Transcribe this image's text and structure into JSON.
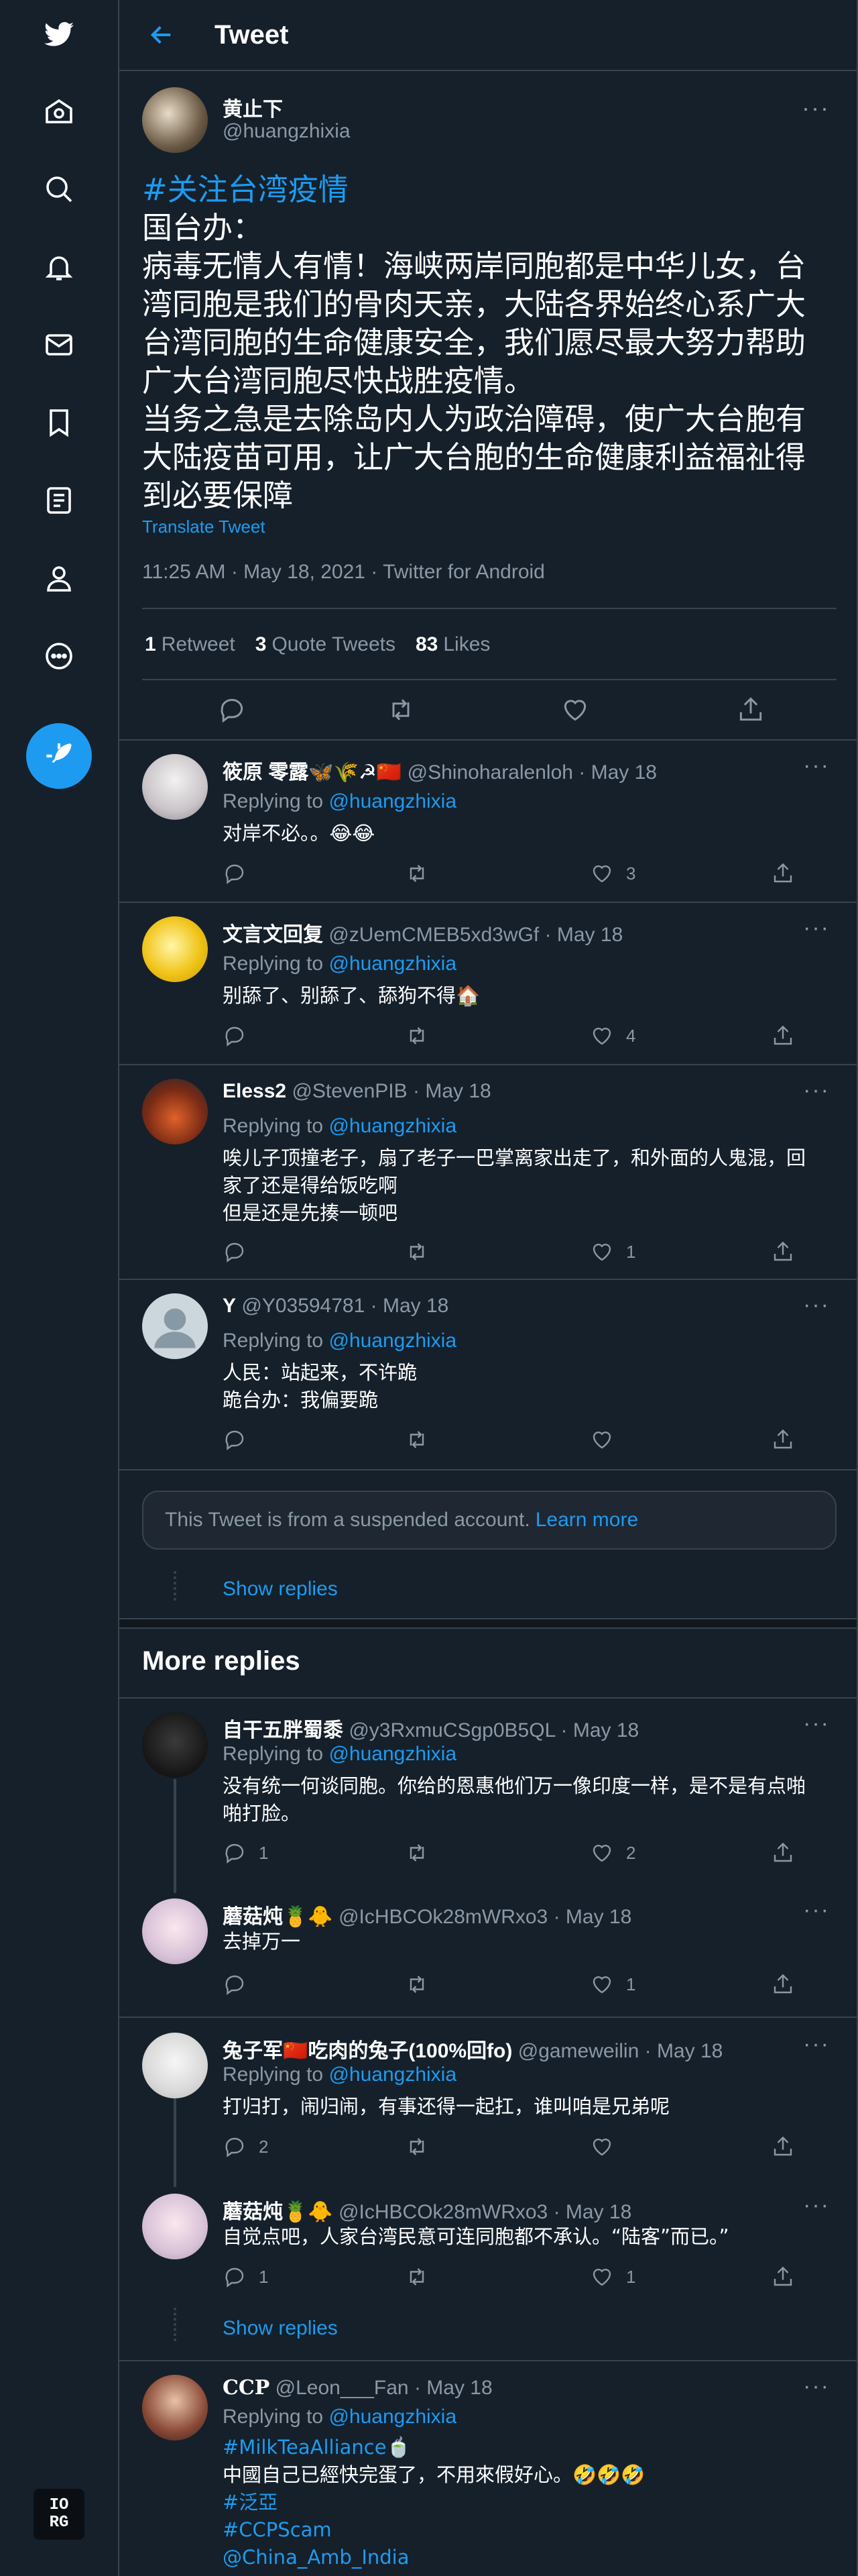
{
  "header": {
    "title": "Tweet"
  },
  "sidebar": {
    "icons": [
      "twitter-logo-icon",
      "home-icon",
      "explore-icon",
      "notifications-icon",
      "messages-icon",
      "bookmarks-icon",
      "lists-icon",
      "profile-icon",
      "more-icon",
      "compose-tweet-icon"
    ],
    "account_badge_lines": [
      "IO",
      "RG"
    ]
  },
  "main_tweet": {
    "author_name": "黄止下",
    "author_handle": "@huangzhixia",
    "hashtag": "#关注台湾疫情",
    "lines": [
      "国台办：",
      "病毒无情人有情！海峡两岸同胞都是中华儿女，台",
      "湾同胞是我们的骨肉天亲，大陆各界始终心系广大",
      "台湾同胞的生命健康安全，我们愿尽最大努力帮助",
      "广大台湾同胞尽快战胜疫情。",
      "当务之急是去除岛内人为政治障碍，使广大台胞有",
      "大陆疫苗可用，让广大台胞的生命健康利益福祉得",
      "到必要保障"
    ],
    "translate": "Translate Tweet",
    "meta": "11:25 AM · May 18, 2021 · Twitter for Android",
    "retweets": "1",
    "retweets_label": "Retweet",
    "quotes": "3",
    "quotes_label": "Quote Tweets",
    "likes": "83",
    "likes_label": "Likes"
  },
  "replies": [
    {
      "name": "筱原 零露🦋🌾☭🇨🇳",
      "handle": "@Shinoharalenloh",
      "date": "May 18",
      "replying_prefix": "Replying to",
      "replying_to": "@huangzhixia",
      "lines": [
        "对岸不必。。😂😂"
      ],
      "comments": "",
      "retweets": "",
      "likes": "3"
    },
    {
      "name": "文言文回复",
      "handle": "@zUemCMEB5xd3wGf",
      "date": "May 18",
      "replying_prefix": "Replying to",
      "replying_to": "@huangzhixia",
      "lines": [
        "别舔了、别舔了、舔狗不得🏠"
      ],
      "comments": "",
      "retweets": "",
      "likes": "4"
    },
    {
      "name": "Eless2",
      "handle": "@StevenPIB",
      "date": "May 18",
      "replying_prefix": "Replying to",
      "replying_to": "@huangzhixia",
      "lines": [
        "唉儿子顶撞老子，扇了老子一巴掌离家出走了，和外面的人鬼混，回",
        "家了还是得给饭吃啊",
        "但是还是先揍一顿吧"
      ],
      "comments": "",
      "retweets": "",
      "likes": "1"
    },
    {
      "name": "Y",
      "handle": "@Y03594781",
      "date": "May 18",
      "replying_prefix": "Replying to",
      "replying_to": "@huangzhixia",
      "lines": [
        "人民：站起来，不许跪",
        "跪台办：我偏要跪"
      ],
      "comments": "",
      "retweets": "",
      "likes": ""
    }
  ],
  "suspended": {
    "text": "This Tweet is from a suspended account.",
    "link": "Learn more"
  },
  "show_replies": "Show replies",
  "more_replies_title": "More replies",
  "more_replies": [
    {
      "name": "自干五胖蜀黍",
      "handle": "@y3RxmuCSgp0B5QL",
      "date": "May 18",
      "replying_prefix": "Replying to",
      "replying_to": "@huangzhixia",
      "lines": [
        "没有统一何谈同胞。你给的恩惠他们万一像印度一样，是不是有点啪",
        "啪打脸。"
      ],
      "comments": "1",
      "retweets": "",
      "likes": "2"
    },
    {
      "name": "蘑菇炖🍍🐥",
      "handle": "@IcHBCOk28mWRxo3",
      "date": "May 18",
      "lines": [
        "去掉万一"
      ],
      "comments": "",
      "retweets": "",
      "likes": "1"
    },
    {
      "name": "兔子军🇨🇳吃肉的兔子(100%回fo)",
      "handle": "@gameweilin",
      "date": "May 18",
      "replying_prefix": "Replying to",
      "replying_to": "@huangzhixia",
      "lines": [
        "打归打，闹归闹，有事还得一起扛，谁叫咱是兄弟呢"
      ],
      "comments": "2",
      "retweets": "",
      "likes": ""
    },
    {
      "name": "蘑菇炖🍍🐥",
      "handle": "@IcHBCOk28mWRxo3",
      "date": "May 18",
      "lines": [
        "自觉点吧，人家台湾民意可连同胞都不承认。“陆客”而已。”"
      ],
      "comments": "1",
      "retweets": "",
      "likes": "1"
    },
    {
      "name": "CCP",
      "handle": "@Leon___Fan",
      "date": "May 18",
      "replying_prefix": "Replying to",
      "replying_to": "@huangzhixia",
      "hashtag1": "#MilkTeaAlliance🍵",
      "line1": "中國自己已經快完蛋了，不用來假好心。🤣🤣🤣",
      "hashtag2": "#泛亞",
      "hashtag3": "#CCPScam",
      "mention": "@China_Amb_India"
    }
  ],
  "colors": {
    "background": "#15202b",
    "accent": "#1d9bf0",
    "secondary_text": "#8b98a5",
    "border": "#38444d"
  }
}
